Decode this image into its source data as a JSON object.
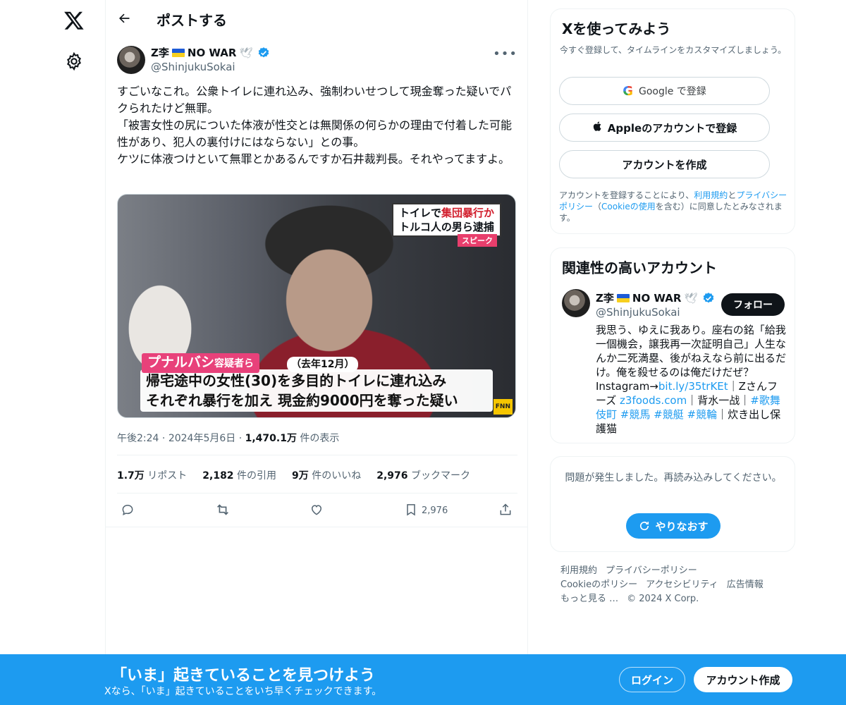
{
  "nav": {
    "logo_icon": "x-logo-icon",
    "settings_icon": "gear-icon"
  },
  "header": {
    "title": "ポストする"
  },
  "tweet": {
    "author_name": "Z李",
    "author_tag": "NO WAR",
    "author_handle": "@ShinjukuSokai",
    "text": "すごいなこれ。公衆トイレに連れ込み、強制わいせつして現金奪った疑いでパクられたけど無罪。\n「被害女性の尻についた体液が性交とは無関係の何らかの理由で付着した可能性があり、犯人の裏付けにはならない」との事。\nケツに体液つけといて無罪とかあるんですか石井裁判長。それやってますよ。",
    "media": {
      "caption_top_line1_prefix": "トイレで",
      "caption_top_line1_red": "集団暴行か",
      "caption_top_line2": "トルコ人の男ら逮捕",
      "caption_speak": "スピーク",
      "caption_name": "プナルバシ",
      "caption_name_suffix": "容疑者ら",
      "caption_date": "（去年12月）",
      "caption_line1": "帰宅途中の女性(30)を多目的トイレに連れ込み",
      "caption_line2": "それぞれ暴行を加え 現金約9000円を奪った疑い",
      "caption_logo": "FNN"
    },
    "time": "午後2:24",
    "date": "2024年5月6日",
    "views_value": "1,470.1万",
    "views_label": "件の表示",
    "stats": {
      "reposts_value": "1.7万",
      "reposts_label": "リポスト",
      "quotes_value": "2,182",
      "quotes_label": "件の引用",
      "likes_value": "9万",
      "likes_label": "件のいいね",
      "bookmarks_value": "2,976",
      "bookmarks_label": "ブックマーク"
    },
    "bookmark_count": "2,976"
  },
  "signup": {
    "title": "Xを使ってみよう",
    "subtitle": "今すぐ登録して、タイムラインをカスタマイズしましょう。",
    "google_label": "Google で登録",
    "apple_label": "Appleのアカウントで登録",
    "create_label": "アカウントを作成",
    "terms_prefix": "アカウントを登録することにより、",
    "terms_link1": "利用規約",
    "terms_and": "と",
    "terms_link2": "プライバシーポリシー",
    "terms_paren_open": "（",
    "terms_link3": "Cookieの使用",
    "terms_suffix": "を含む）に同意したとみなされます。"
  },
  "related": {
    "title": "関連性の高いアカウント",
    "name": "Z李",
    "tag": "NO WAR",
    "handle": "@ShinjukuSokai",
    "follow_label": "フォロー",
    "bio_part1": "我思う、ゆえに我あり。座右の銘「給我一個機会，譲我再一次証明自己」人生なんか二死満塁、後がねえなら前に出るだけ。俺を殺せるのは俺だけだぜ？ Instagram→",
    "bio_link1": "bit.ly/35trKEt",
    "bio_part2": "｜Zさんフーズ ",
    "bio_link2": "z3foods.com",
    "bio_part3": "｜背水一战｜",
    "bio_link3": "#歌舞伎町",
    "bio_link4": "#競馬",
    "bio_link5": "#競艇",
    "bio_link6": "#競輪",
    "bio_part4": "｜炊き出し保護猫"
  },
  "error": {
    "message": "問題が発生しました。再読み込みしてください。",
    "retry_label": "やりなおす"
  },
  "footer": {
    "terms": "利用規約",
    "privacy": "プライバシーポリシー",
    "cookie": "Cookieのポリシー",
    "accessibility": "アクセシビリティ",
    "ads": "広告情報",
    "more": "もっと見る …",
    "copyright": "© 2024 X Corp."
  },
  "bottombar": {
    "title": "「いま」起きていることを見つけよう",
    "subtitle": "Xなら、「いま」起きていることをいち早くチェックできます。",
    "login_label": "ログイン",
    "create_label": "アカウント作成"
  },
  "colors": {
    "accent": "#1d9bf0",
    "text": "#0f1419",
    "muted": "#536471"
  }
}
